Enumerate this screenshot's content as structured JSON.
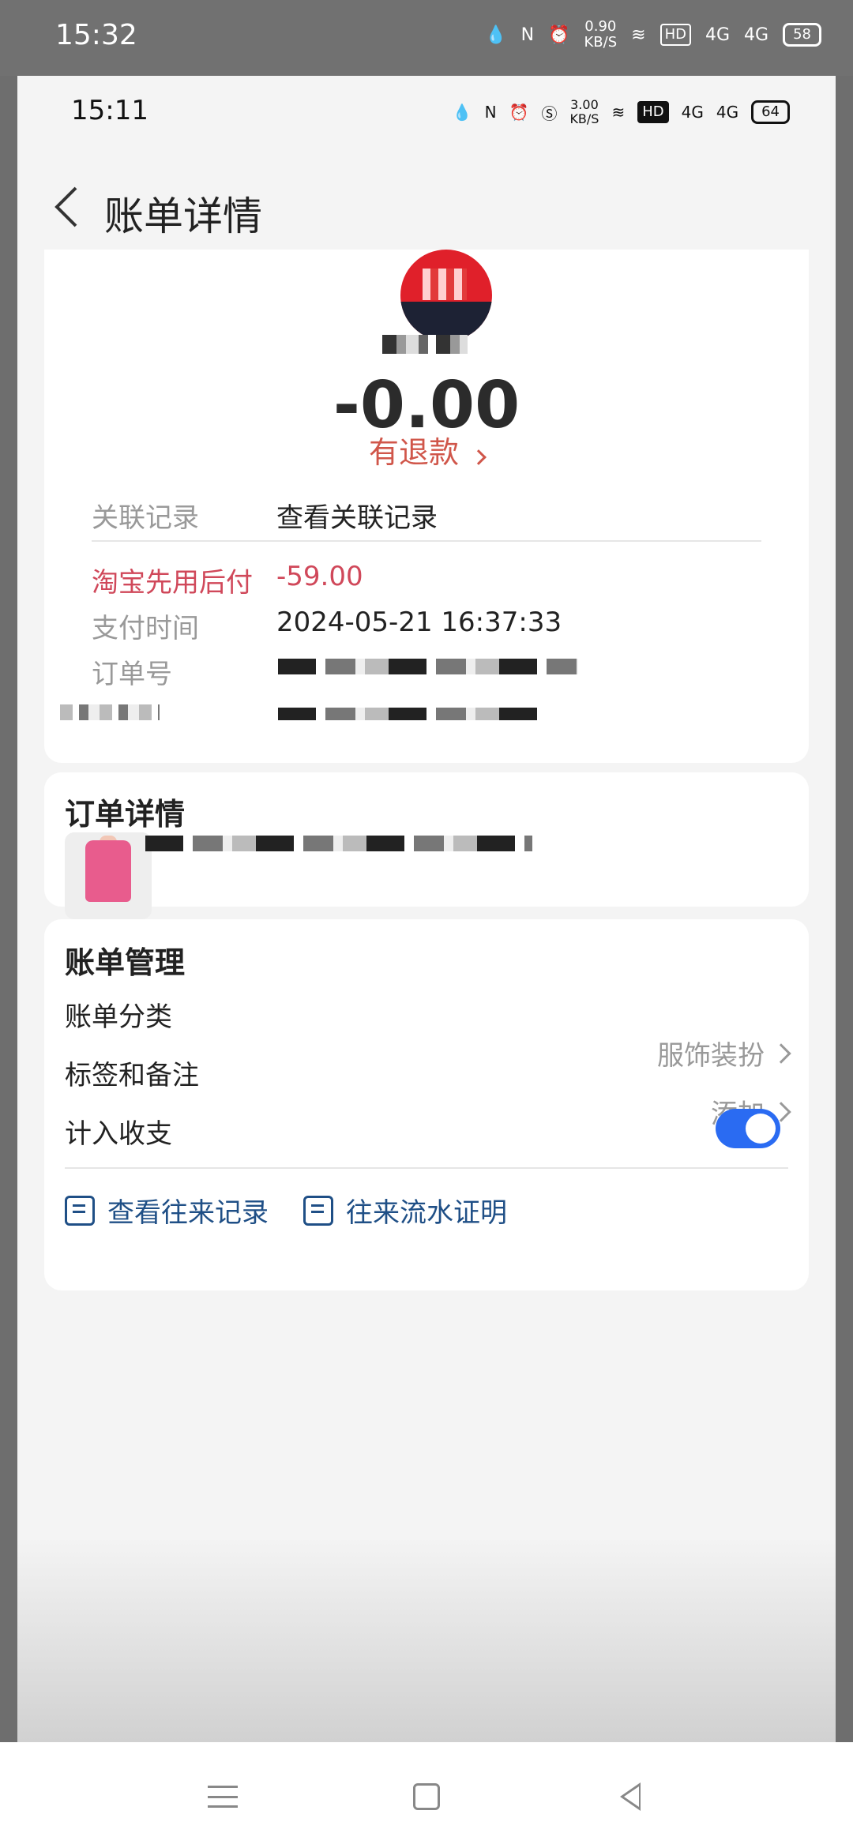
{
  "outer_status": {
    "time": "15:32",
    "net_speed_top": "0.90",
    "net_speed_bottom": "KB/S",
    "hd": "HD",
    "network1": "4G",
    "network2": "4G",
    "battery": "58"
  },
  "inner_status": {
    "time": "15:11",
    "net_speed_top": "3.00",
    "net_speed_bottom": "KB/S",
    "hd": "HD",
    "network1": "4G",
    "network2": "4G",
    "battery": "64"
  },
  "header": {
    "title": "账单详情"
  },
  "bill": {
    "amount": "-0.00",
    "refund_label": "有退款",
    "rows": {
      "related_label": "关联记录",
      "related_value": "查看关联记录",
      "taobao_label": "淘宝先用后付",
      "taobao_value": "-59.00",
      "pay_time_label": "支付时间",
      "pay_time_value": "2024-05-21 16:37:33",
      "order_no_label": "订单号"
    }
  },
  "order_details": {
    "title": "订单详情"
  },
  "bill_management": {
    "title": "账单管理",
    "category_label": "账单分类",
    "category_value": "服饰装扮",
    "tags_label": "标签和备注",
    "tags_value": "添加",
    "include_label": "计入收支",
    "include_on": true,
    "action1": "查看往来记录",
    "action2": "往来流水证明"
  },
  "colors": {
    "accent_blue": "#2a6bf2",
    "link_blue": "#1f4f86",
    "refund_red": "#d0564a"
  }
}
